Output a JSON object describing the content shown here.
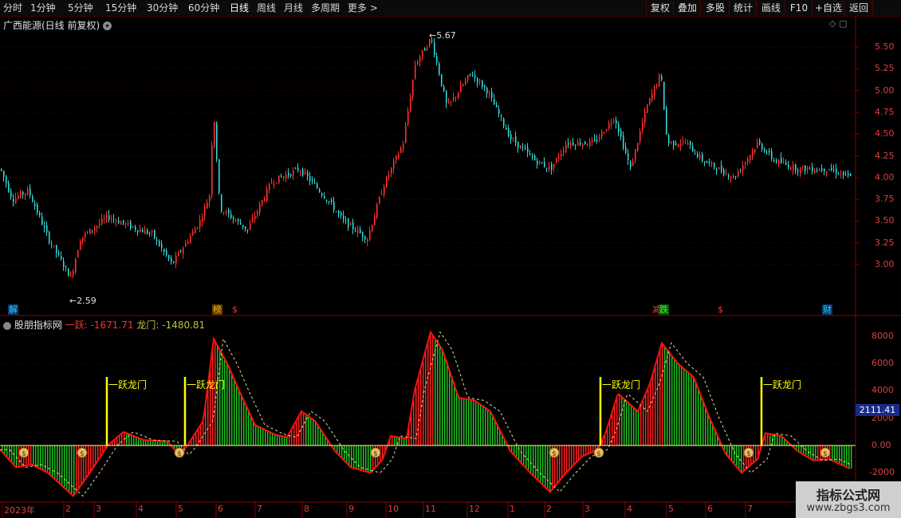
{
  "toolbar": {
    "periods": [
      "分时",
      "1分钟",
      "5分钟",
      "15分钟",
      "30分钟",
      "60分钟",
      "日线",
      "周线",
      "月线",
      "多周期",
      "更多"
    ],
    "active_period": "日线",
    "more_arrow": ">",
    "right_buttons": [
      "复权",
      "叠加",
      "多股",
      "统计",
      "画线",
      "F10",
      "+自选",
      "返回"
    ]
  },
  "main_panel": {
    "title": "广西能源(日线 前复权)",
    "dropdown_icon": "chevron-down-circle-icon",
    "price_axis": [
      "5.50",
      "5.25",
      "5.00",
      "4.75",
      "4.50",
      "4.25",
      "4.00",
      "3.75",
      "3.50",
      "3.25",
      "3.00"
    ],
    "high_label": "5.67",
    "low_label": "2.59",
    "markers": [
      {
        "text": "解",
        "color": "#22c8ff"
      },
      {
        "text": "榜",
        "color": "#ffb000"
      },
      {
        "text": "$",
        "color": "#ff3030"
      },
      {
        "text": "减",
        "color": "#ff4040"
      },
      {
        "text": "跌",
        "color": "#30ff30"
      },
      {
        "text": "$",
        "color": "#ff3030"
      },
      {
        "text": "财",
        "color": "#22c8ff"
      }
    ]
  },
  "indicator_panel": {
    "title": "股朋指标网",
    "series1_label": "一跃",
    "series1_value": "-1671.71",
    "series2_label": "龙门",
    "series2_value": "-1480.81",
    "axis": [
      "8000",
      "6000",
      "4000",
      "2000",
      "0.00",
      "-2000"
    ],
    "current_value": "2111.41",
    "tag_text": "一跃龙门",
    "coin_symbol": "$"
  },
  "x_axis": [
    "2023年",
    "2",
    "3",
    "4",
    "5",
    "6",
    "7",
    "8",
    "9",
    "10",
    "11",
    "12",
    "1",
    "2",
    "3",
    "4",
    "5",
    "6",
    "7"
  ],
  "watermark": {
    "line1": "指标公式网",
    "line2": "www.zbgs3.com"
  },
  "colors": {
    "up": "#ff3030",
    "down": "#30d8d8",
    "bar_up": "#ff2020",
    "bar_down": "#20c020",
    "grid": "#5a0000",
    "tag": "#ffff00"
  }
}
